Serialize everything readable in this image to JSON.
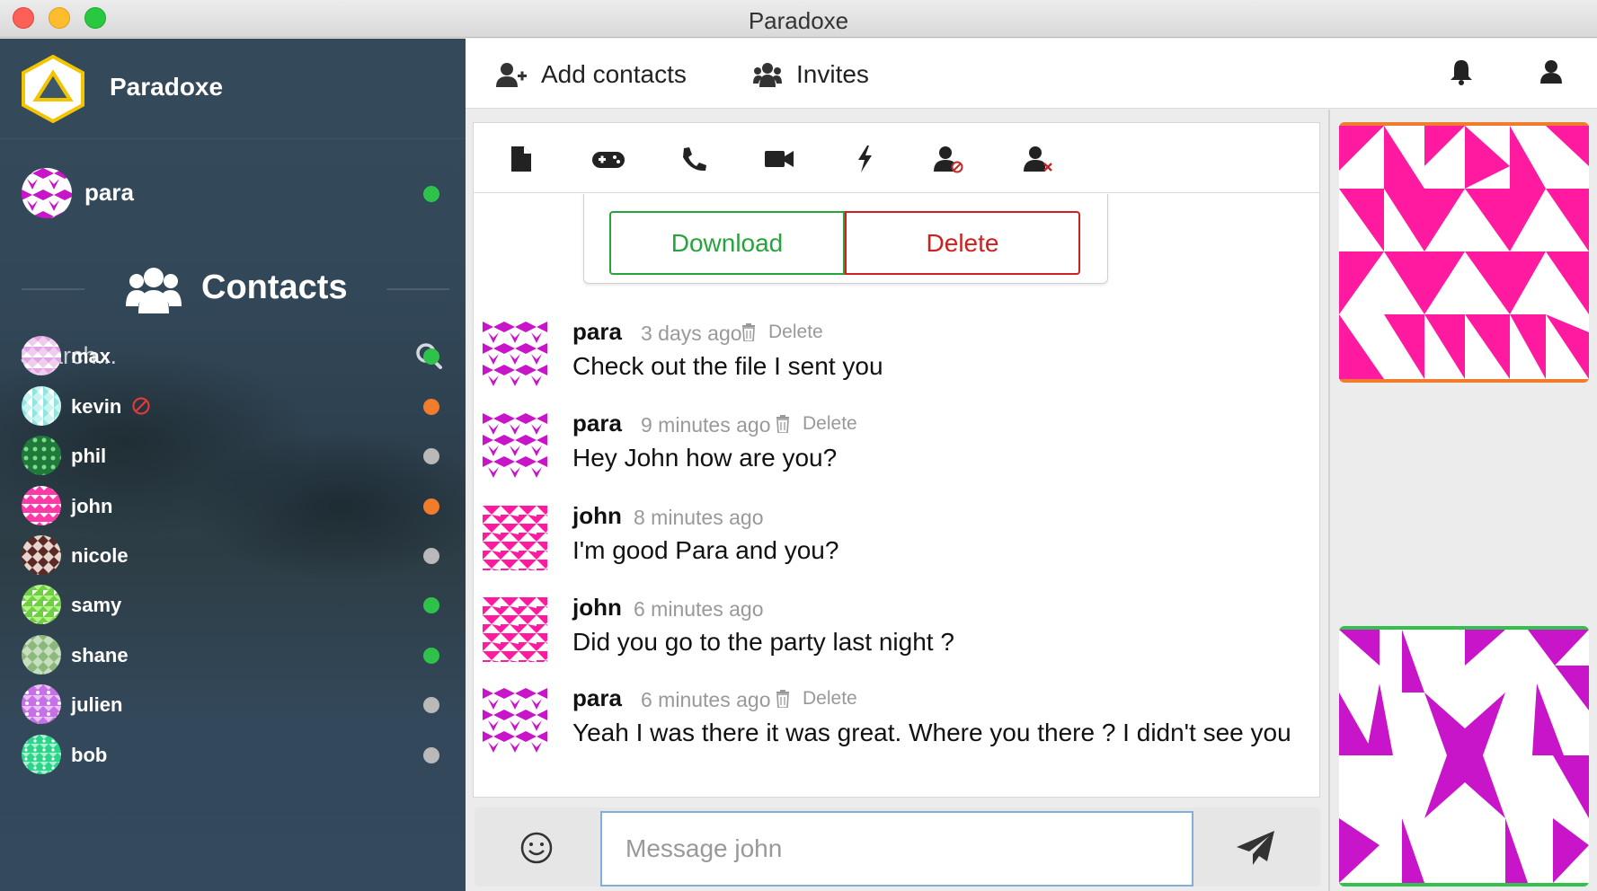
{
  "window": {
    "title": "Paradoxe"
  },
  "brand": {
    "name": "Paradoxe"
  },
  "me": {
    "name": "para",
    "status": "online"
  },
  "contacts_header": {
    "label": "Contacts"
  },
  "search": {
    "placeholder": "Search..."
  },
  "contacts": [
    {
      "name": "max",
      "status": "online",
      "blocked": false
    },
    {
      "name": "kevin",
      "status": "away",
      "blocked": true
    },
    {
      "name": "phil",
      "status": "offline",
      "blocked": false
    },
    {
      "name": "john",
      "status": "away",
      "blocked": false
    },
    {
      "name": "nicole",
      "status": "offline",
      "blocked": false
    },
    {
      "name": "samy",
      "status": "online",
      "blocked": false
    },
    {
      "name": "shane",
      "status": "online",
      "blocked": false
    },
    {
      "name": "julien",
      "status": "offline",
      "blocked": false
    },
    {
      "name": "bob",
      "status": "offline",
      "blocked": false
    }
  ],
  "topbar": {
    "add_contacts": "Add contacts",
    "invites": "Invites"
  },
  "toolbar_icons": [
    "file-icon",
    "gamepad-icon",
    "phone-icon",
    "video-camera-icon",
    "bolt-icon",
    "user-block-icon",
    "user-remove-icon"
  ],
  "file_card": {
    "download_label": "Download",
    "delete_label": "Delete"
  },
  "messages": [
    {
      "author": "para",
      "time": "3 days ago",
      "delete_label": "Delete",
      "text": "Check out the file I sent you"
    },
    {
      "author": "para",
      "time": "9 minutes ago",
      "delete_label": "Delete",
      "text": "Hey John how are you?"
    },
    {
      "author": "john",
      "time": "8 minutes ago",
      "text": "I'm good Para and you?"
    },
    {
      "author": "john",
      "time": "6 minutes ago",
      "text": "Did you go to the party last night ?"
    },
    {
      "author": "para",
      "time": "6 minutes ago",
      "delete_label": "Delete",
      "text": "Yeah I was there it was great. Where you there ? I didn't see you"
    }
  ],
  "composer": {
    "placeholder": "Message john"
  },
  "colors": {
    "online": "#2fc24a",
    "away": "#f07c2c",
    "offline": "#b9b9b9",
    "download": "#27a33c",
    "delete": "#cf2020",
    "sidebar_bg": "#34495a",
    "identicon_para": "#c815c9",
    "identicon_john": "#ff1aa0"
  }
}
